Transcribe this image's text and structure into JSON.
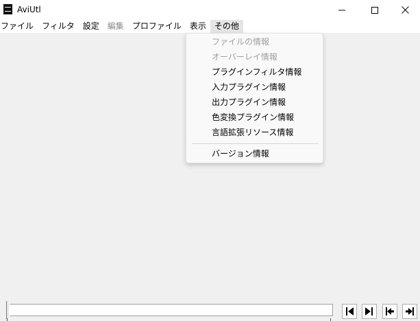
{
  "window": {
    "title": "AviUtl",
    "icon": "film-strip-icon"
  },
  "menubar": {
    "items": [
      {
        "label": "ファイル",
        "enabled": true
      },
      {
        "label": "フィルタ",
        "enabled": true
      },
      {
        "label": "設定",
        "enabled": true
      },
      {
        "label": "編集",
        "enabled": false
      },
      {
        "label": "プロファイル",
        "enabled": true
      },
      {
        "label": "表示",
        "enabled": true
      },
      {
        "label": "その他",
        "enabled": true,
        "open": true
      }
    ]
  },
  "dropdown": {
    "items": [
      {
        "label": "ファイルの情報",
        "enabled": false
      },
      {
        "label": "オーバーレイ情報",
        "enabled": false
      },
      {
        "label": "プラグインフィルタ情報",
        "enabled": true
      },
      {
        "label": "入力プラグイン情報",
        "enabled": true
      },
      {
        "label": "出力プラグイン情報",
        "enabled": true
      },
      {
        "label": "色変換プラグイン情報",
        "enabled": true
      },
      {
        "label": "言語拡張リソース情報",
        "enabled": true
      },
      {
        "label": "バージョン情報",
        "enabled": true
      }
    ]
  },
  "transport": {
    "buttons": [
      "prev-frame-icon",
      "next-frame-icon",
      "go-to-start-icon",
      "go-to-end-icon"
    ]
  }
}
